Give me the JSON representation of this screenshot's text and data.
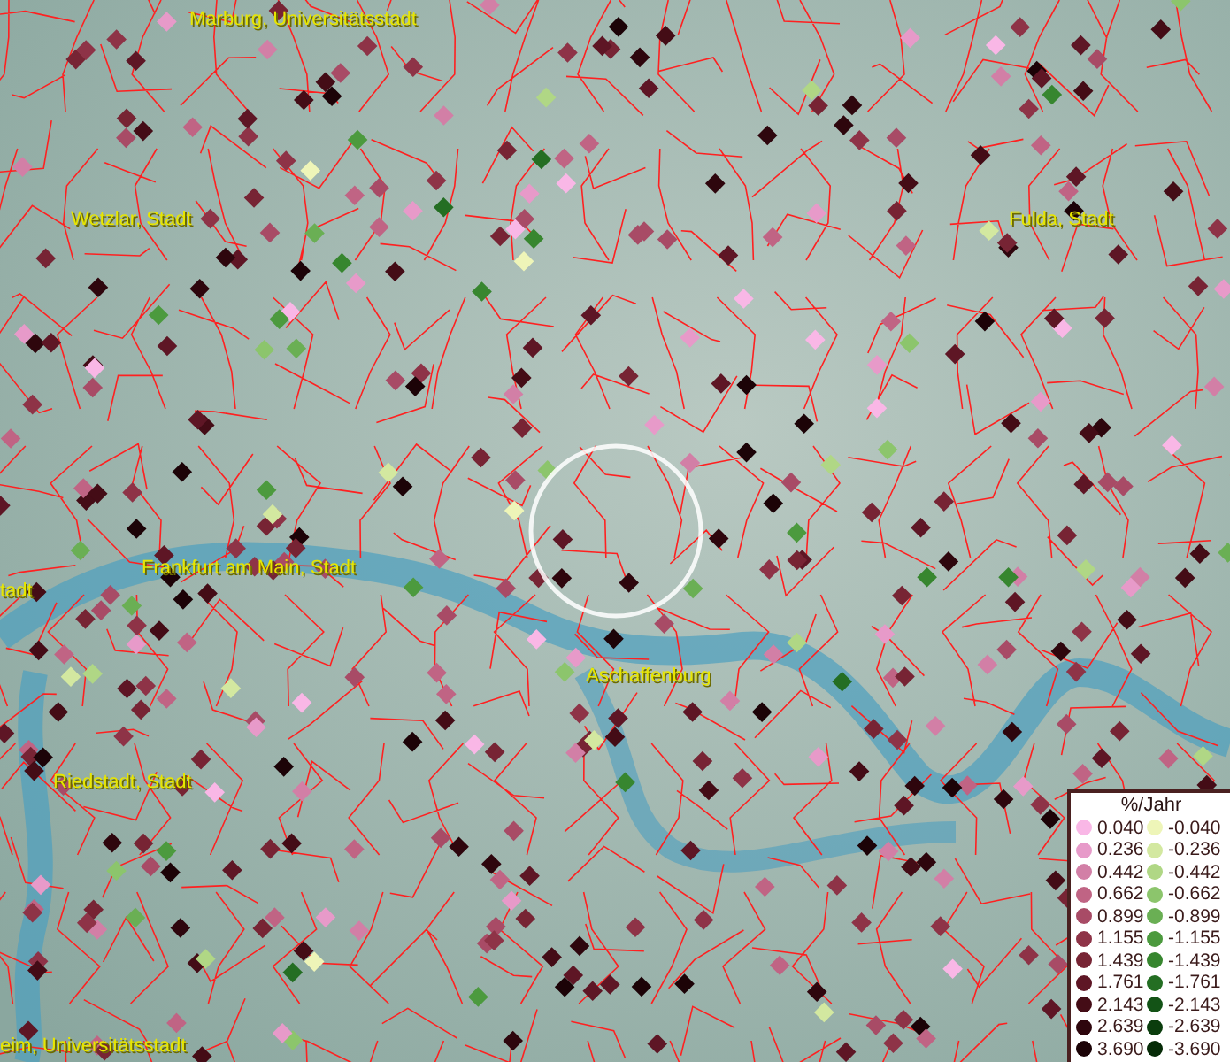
{
  "map": {
    "place_labels": [
      {
        "text": "Marburg, Universitätsstadt"
      },
      {
        "text": "Wetzlar, Stadt"
      },
      {
        "text": "Fulda, Stadt"
      },
      {
        "text": "tadt"
      },
      {
        "text": "Frankfurt am Main, Stadt"
      },
      {
        "text": "Aschaffenburg"
      },
      {
        "text": "Riedstadt, Stadt"
      },
      {
        "text": "eim, Universitätsstadt"
      }
    ]
  },
  "legend": {
    "title": "%/Jahr",
    "items": [
      {
        "label": "0.040",
        "color": "#f9b7e6"
      },
      {
        "label": "-0.040",
        "color": "#eef5b8"
      },
      {
        "label": "0.236",
        "color": "#e79ac9"
      },
      {
        "label": "-0.236",
        "color": "#d3e8a0"
      },
      {
        "label": "0.442",
        "color": "#d27fa6"
      },
      {
        "label": "-0.442",
        "color": "#b0d785"
      },
      {
        "label": "0.662",
        "color": "#c06484"
      },
      {
        "label": "-0.662",
        "color": "#8cc56c"
      },
      {
        "label": "0.899",
        "color": "#a84b66"
      },
      {
        "label": "-0.899",
        "color": "#6aaf54"
      },
      {
        "label": "1.155",
        "color": "#8e3347"
      },
      {
        "label": "-1.155",
        "color": "#4c9a3e"
      },
      {
        "label": "1.439",
        "color": "#772434"
      },
      {
        "label": "-1.439",
        "color": "#37862f"
      },
      {
        "label": "1.761",
        "color": "#5e1625"
      },
      {
        "label": "-1.761",
        "color": "#246e23"
      },
      {
        "label": "2.143",
        "color": "#440c16"
      },
      {
        "label": "-2.143",
        "color": "#135316"
      },
      {
        "label": "2.639",
        "color": "#2e060d"
      },
      {
        "label": "-2.639",
        "color": "#0b3d0d"
      },
      {
        "label": "3.690",
        "color": "#1c0307"
      },
      {
        "label": "-3.690",
        "color": "#062b07"
      }
    ]
  }
}
